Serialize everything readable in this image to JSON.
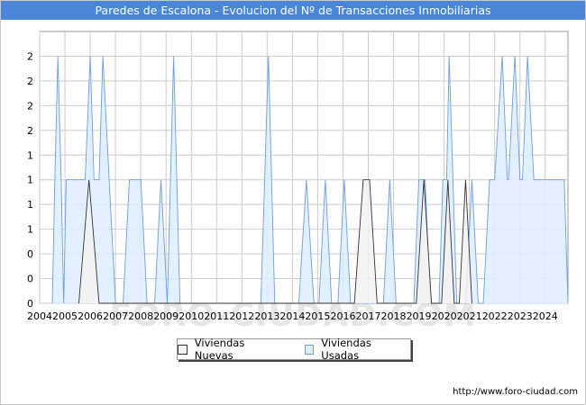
{
  "title": "Paredes de Escalona - Evolucion del Nº de Transacciones Inmobiliarias",
  "source_url": "http://www.foro-ciudad.com",
  "watermark": "FORO-CIUDAD.COM",
  "legend": {
    "nuevas_label": "Viviendas Nuevas",
    "usadas_label": "Viviendas Usadas"
  },
  "colors": {
    "title_bg": "#4a86d9",
    "nuevas_fill": "#f2f2f2",
    "nuevas_stroke": "#333333",
    "usadas_fill": "#ddeeff",
    "usadas_stroke": "#6f9de0",
    "grid": "#cccccc"
  },
  "chart_data": {
    "type": "area",
    "title": "Paredes de Escalona - Evolucion del Nº de Transacciones Inmobiliarias",
    "xlabel": "",
    "ylabel": "",
    "ylim": [
      0,
      2.2
    ],
    "x_range": [
      2004,
      2024.9
    ],
    "grid": true,
    "legend_position": "bottom",
    "y_tick_labels": [
      "0",
      "0",
      "0",
      "1",
      "1",
      "1",
      "1",
      "2",
      "2",
      "2",
      "2"
    ],
    "y_tick_values": [
      0,
      0.2,
      0.4,
      0.6,
      0.8,
      1.0,
      1.2,
      1.4,
      1.6,
      1.8,
      2.0
    ],
    "x_tick_labels": [
      "2004",
      "2005",
      "2006",
      "2007",
      "2008",
      "2009",
      "2010",
      "2011",
      "2012",
      "2013",
      "2014",
      "2015",
      "2016",
      "2017",
      "2018",
      "2019",
      "2020",
      "2021",
      "2022",
      "2023",
      "2024"
    ],
    "series": [
      {
        "name": "Viviendas Usadas",
        "points": [
          [
            2004.5,
            0
          ],
          [
            2004.6,
            1
          ],
          [
            2004.72,
            2
          ],
          [
            2004.85,
            1
          ],
          [
            2004.95,
            0
          ],
          [
            2005.05,
            1
          ],
          [
            2005.8,
            1
          ],
          [
            2006.0,
            2
          ],
          [
            2006.15,
            1
          ],
          [
            2006.35,
            1
          ],
          [
            2006.5,
            2
          ],
          [
            2006.75,
            1
          ],
          [
            2007.0,
            0
          ],
          [
            2007.3,
            0
          ],
          [
            2007.55,
            1
          ],
          [
            2008.0,
            1
          ],
          [
            2008.25,
            0
          ],
          [
            2008.55,
            0
          ],
          [
            2008.8,
            1
          ],
          [
            2009.05,
            0
          ],
          [
            2009.3,
            2
          ],
          [
            2009.55,
            0
          ],
          [
            2012.75,
            0
          ],
          [
            2013.05,
            2
          ],
          [
            2013.3,
            0
          ],
          [
            2014.25,
            0
          ],
          [
            2014.55,
            1
          ],
          [
            2014.85,
            0
          ],
          [
            2015.05,
            0
          ],
          [
            2015.3,
            1
          ],
          [
            2015.55,
            0
          ],
          [
            2015.8,
            0
          ],
          [
            2016.05,
            1
          ],
          [
            2016.3,
            0
          ],
          [
            2017.6,
            0
          ],
          [
            2017.85,
            1
          ],
          [
            2018.1,
            0
          ],
          [
            2018.8,
            0
          ],
          [
            2019.0,
            1
          ],
          [
            2019.25,
            1
          ],
          [
            2019.45,
            0
          ],
          [
            2019.8,
            0
          ],
          [
            2019.95,
            1
          ],
          [
            2020.1,
            1
          ],
          [
            2020.2,
            2
          ],
          [
            2020.35,
            1
          ],
          [
            2020.5,
            0
          ],
          [
            2020.85,
            0
          ],
          [
            2021.1,
            1
          ],
          [
            2021.35,
            0
          ],
          [
            2021.55,
            0
          ],
          [
            2021.8,
            1
          ],
          [
            2022.0,
            1
          ],
          [
            2022.3,
            2
          ],
          [
            2022.5,
            1
          ],
          [
            2022.55,
            1
          ],
          [
            2022.8,
            2
          ],
          [
            2023.0,
            1
          ],
          [
            2023.1,
            1
          ],
          [
            2023.3,
            2
          ],
          [
            2023.55,
            1
          ],
          [
            2024.75,
            1
          ],
          [
            2024.9,
            0
          ]
        ]
      },
      {
        "name": "Viviendas Nuevas",
        "points": [
          [
            2005.55,
            0
          ],
          [
            2005.95,
            1
          ],
          [
            2006.35,
            0
          ],
          [
            2016.45,
            0
          ],
          [
            2016.8,
            1
          ],
          [
            2017.05,
            1
          ],
          [
            2017.35,
            0
          ],
          [
            2018.9,
            0
          ],
          [
            2019.2,
            1
          ],
          [
            2019.5,
            0
          ],
          [
            2019.9,
            0
          ],
          [
            2020.15,
            1
          ],
          [
            2020.4,
            0
          ],
          [
            2020.6,
            0
          ],
          [
            2020.85,
            1
          ],
          [
            2021.1,
            0
          ]
        ]
      }
    ]
  }
}
